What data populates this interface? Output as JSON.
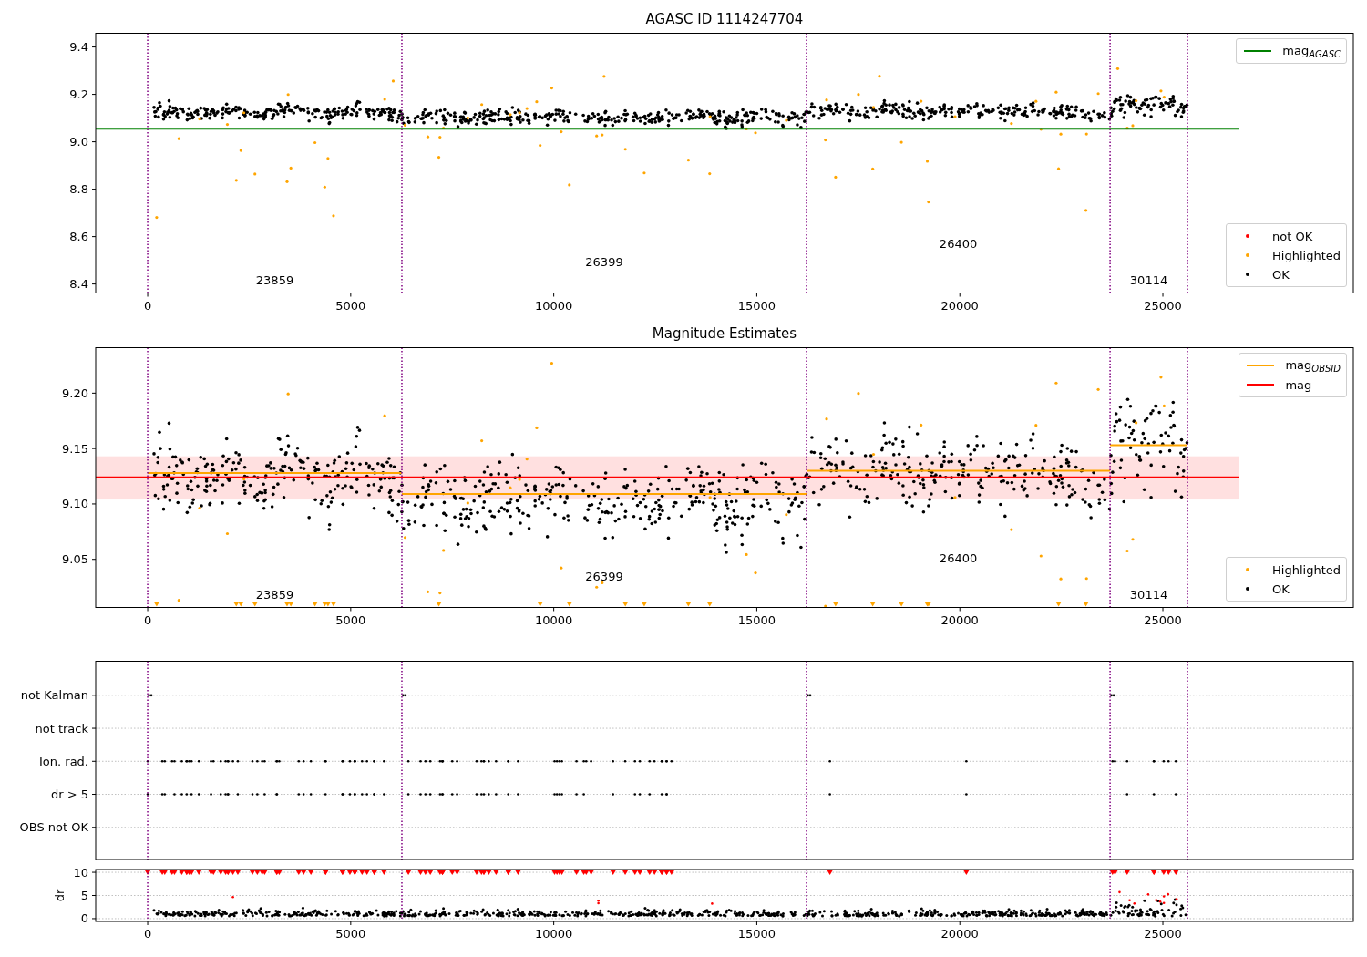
{
  "figure": {
    "panels": [
      {
        "kind": "magnitude",
        "title": "AGASC ID 1114247704",
        "chart_data": {
          "type": "scatter",
          "xlim": [
            -1280,
            29690
          ],
          "ylim": [
            8.362,
            9.458
          ],
          "xticks": [
            {
              "value": 0,
              "label": "0"
            },
            {
              "value": 5000,
              "label": "5000"
            },
            {
              "value": 10000,
              "label": "10000"
            },
            {
              "value": 15000,
              "label": "15000"
            },
            {
              "value": 20000,
              "label": "20000"
            },
            {
              "value": 25000,
              "label": "25000"
            }
          ],
          "yticks": [
            {
              "value": 8.4,
              "label": "8.4"
            },
            {
              "value": 8.6,
              "label": "8.6"
            },
            {
              "value": 8.8,
              "label": "8.8"
            },
            {
              "value": 9.0,
              "label": "9.0"
            },
            {
              "value": 9.2,
              "label": "9.2"
            },
            {
              "value": 9.4,
              "label": "9.4"
            }
          ],
          "series": [
            {
              "type": "line",
              "color": "#008000",
              "x": [
                -1280,
                26880
              ],
              "values": [
                9.055,
                9.055
              ]
            }
          ],
          "ref_lines": [
            {
              "axis": "x",
              "value": 0,
              "color": "#800080"
            },
            {
              "axis": "x",
              "value": 6260,
              "color": "#800080"
            },
            {
              "axis": "x",
              "value": 16225,
              "color": "#800080"
            },
            {
              "axis": "x",
              "value": 23700,
              "color": "#800080"
            },
            {
              "axis": "x",
              "value": 25605,
              "color": "#800080"
            }
          ],
          "annotations": [
            "23859",
            "26399",
            "26400",
            "30114"
          ]
        },
        "legends": [
          {
            "items": [
              {
                "label": "mag$_{AGASC}$",
                "kind": "line",
                "color": "#008000"
              }
            ]
          },
          {
            "items": [
              {
                "label": "not OK",
                "kind": "dot",
                "color": "#ff0000"
              },
              {
                "label": "Highlighted",
                "kind": "dot",
                "color": "#ffa500"
              },
              {
                "label": "OK",
                "kind": "dot",
                "color": "#000000"
              }
            ]
          }
        ]
      },
      {
        "kind": "magnitude",
        "title": "Magnitude Estimates",
        "chart_data": {
          "type": "scatter",
          "xlim": [
            -1280,
            29690
          ],
          "ylim": [
            9.0066,
            9.241
          ],
          "xticks": [
            {
              "value": 0,
              "label": "0"
            },
            {
              "value": 5000,
              "label": "5000"
            },
            {
              "value": 10000,
              "label": "10000"
            },
            {
              "value": 15000,
              "label": "15000"
            },
            {
              "value": 20000,
              "label": "20000"
            },
            {
              "value": 25000,
              "label": "25000"
            }
          ],
          "yticks": [
            {
              "value": 9.05,
              "label": "9.05"
            },
            {
              "value": 9.1,
              "label": "9.10"
            },
            {
              "value": 9.15,
              "label": "9.15"
            },
            {
              "value": 9.2,
              "label": "9.20"
            }
          ],
          "bands": [
            {
              "axis": "y",
              "from": 9.104,
              "to": 9.143,
              "color": "#ff0000"
            }
          ],
          "series": [
            {
              "type": "line",
              "color": "#ffa500",
              "x": [
                0,
                6260
              ],
              "values": [
                9.128,
                9.128
              ]
            },
            {
              "type": "line",
              "color": "#ffa500",
              "x": [
                6260,
                16225
              ],
              "values": [
                9.109,
                9.109
              ]
            },
            {
              "type": "line",
              "color": "#ffa500",
              "x": [
                16225,
                23700
              ],
              "values": [
                9.13,
                9.13
              ]
            },
            {
              "type": "line",
              "color": "#ffa500",
              "x": [
                23700,
                25605
              ],
              "values": [
                9.153,
                9.153
              ]
            },
            {
              "type": "line",
              "color": "#ff0000",
              "x": [
                -1280,
                26880
              ],
              "values": [
                9.124,
                9.124
              ]
            }
          ],
          "ref_lines": [
            {
              "axis": "x",
              "value": 0,
              "color": "#800080"
            },
            {
              "axis": "x",
              "value": 6260,
              "color": "#800080"
            },
            {
              "axis": "x",
              "value": 16225,
              "color": "#800080"
            },
            {
              "axis": "x",
              "value": 23700,
              "color": "#800080"
            },
            {
              "axis": "x",
              "value": 25605,
              "color": "#800080"
            }
          ],
          "annotations": [
            "23859",
            "26399",
            "26400",
            "30114"
          ]
        },
        "legends": [
          {
            "items": [
              {
                "label": "mag$_{OBSID}$",
                "kind": "line",
                "color": "#ffa500"
              },
              {
                "label": "mag",
                "kind": "line",
                "color": "#ff0000"
              }
            ]
          },
          {
            "items": [
              {
                "label": "Highlighted",
                "kind": "dot",
                "color": "#ffa500"
              },
              {
                "label": "OK",
                "kind": "dot",
                "color": "#000000"
              }
            ]
          }
        ]
      },
      {
        "kind": "flags",
        "chart_data": {
          "type": "scatter",
          "orientation": "horizontal",
          "grid": true,
          "xlim": [
            -1280,
            29690
          ],
          "categories": [
            "not Kalman",
            "not track",
            "Ion. rad.",
            "dr > 5",
            "OBS not OK"
          ],
          "ref_lines": [
            {
              "axis": "x",
              "value": 0,
              "color": "#800080"
            },
            {
              "axis": "x",
              "value": 6260,
              "color": "#800080"
            },
            {
              "axis": "x",
              "value": 16225,
              "color": "#800080"
            },
            {
              "axis": "x",
              "value": 23700,
              "color": "#800080"
            },
            {
              "axis": "x",
              "value": 25605,
              "color": "#800080"
            }
          ]
        }
      },
      {
        "kind": "dr",
        "chart_data": {
          "type": "scatter",
          "grid": true,
          "ylabel": "dr",
          "xlim": [
            -1280,
            29690
          ],
          "ylim": [
            -0.6,
            10.6
          ],
          "xticks": [
            {
              "value": 0,
              "label": "0"
            },
            {
              "value": 5000,
              "label": "5000"
            },
            {
              "value": 10000,
              "label": "10000"
            },
            {
              "value": 15000,
              "label": "15000"
            },
            {
              "value": 20000,
              "label": "20000"
            },
            {
              "value": 25000,
              "label": "25000"
            }
          ],
          "yticks": [
            {
              "value": 0,
              "label": "0"
            },
            {
              "value": 5,
              "label": "5"
            },
            {
              "value": 10,
              "label": "10"
            }
          ],
          "ref_lines": [
            {
              "axis": "x",
              "value": 0,
              "color": "#800080"
            },
            {
              "axis": "x",
              "value": 6260,
              "color": "#800080"
            },
            {
              "axis": "x",
              "value": 16225,
              "color": "#800080"
            },
            {
              "axis": "x",
              "value": 23700,
              "color": "#800080"
            },
            {
              "axis": "x",
              "value": 25605,
              "color": "#800080"
            }
          ]
        }
      }
    ]
  }
}
